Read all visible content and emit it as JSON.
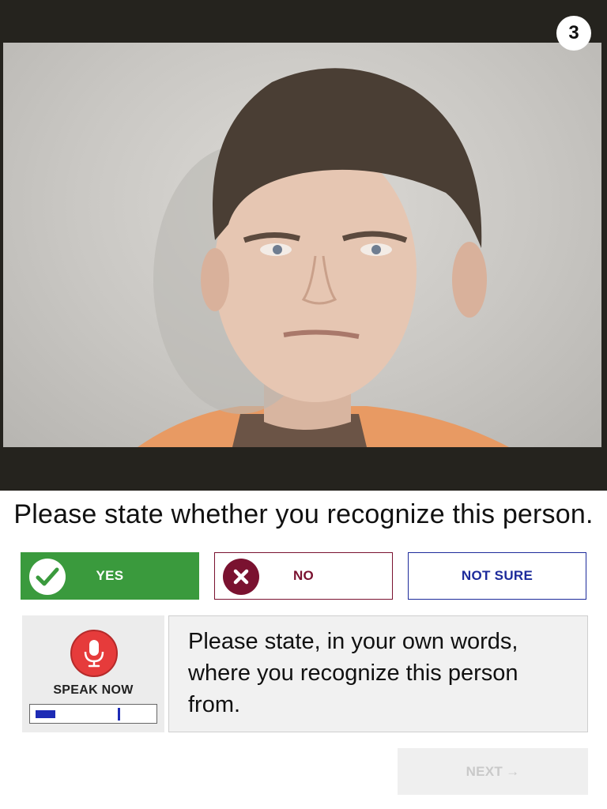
{
  "step": {
    "number": "3"
  },
  "photo": {
    "alt": "Photo of a young man in front of a light gray background"
  },
  "question": {
    "text": "Please state whether you recognize this person."
  },
  "answers": [
    {
      "label": "YES",
      "icon": "check-icon",
      "color": "#3a9a3d"
    },
    {
      "label": "NO",
      "icon": "x-icon",
      "color": "#7a1230"
    },
    {
      "label": "NOT SURE",
      "icon": "",
      "color": "#1d2b9b"
    }
  ],
  "speak": {
    "label": "SPEAK NOW",
    "icon": "microphone-icon",
    "level": 0.17,
    "peak": 0.7
  },
  "prompt": {
    "text": "Please state, in your own words, where you recognize this person from."
  },
  "next": {
    "label": "NEXT",
    "arrow": "→",
    "disabled": true
  }
}
